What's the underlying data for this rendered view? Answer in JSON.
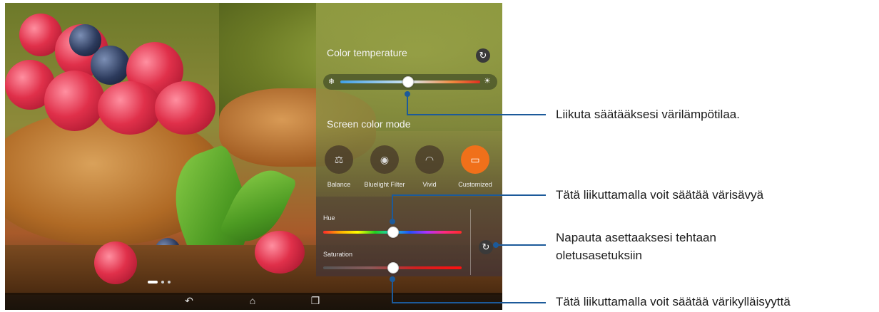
{
  "panel": {
    "color_temperature_label": "Color temperature",
    "color_temperature_value": 0.48,
    "screen_color_mode_label": "Screen color mode",
    "modes": [
      {
        "label": "Balance",
        "icon": "balance-scale-icon",
        "selected": false
      },
      {
        "label": "Bluelight Filter",
        "icon": "eye-shield-icon",
        "selected": false
      },
      {
        "label": "Vivid",
        "icon": "rainbow-icon",
        "selected": false
      },
      {
        "label": "Customized",
        "icon": "custom-display-icon",
        "selected": true
      }
    ],
    "hue_label": "Hue",
    "hue_value": 0.5,
    "saturation_label": "Saturation",
    "saturation_value": 0.5,
    "accent_color": "#f0701a"
  },
  "navbar": {
    "back_icon": "back-icon",
    "home_icon": "home-icon",
    "recents_icon": "recents-icon"
  },
  "callouts": {
    "color_temperature": "Liikuta säätääksesi värilämpötilaa.",
    "hue": "Tätä liikuttamalla voit säätää värisävyä",
    "reset_line1": "Napauta asettaaksesi tehtaan",
    "reset_line2": "oletusasetuksiin",
    "saturation": "Tätä liikuttamalla voit säätää värikylläisyyttä",
    "line_color": "#1c5a9a"
  }
}
